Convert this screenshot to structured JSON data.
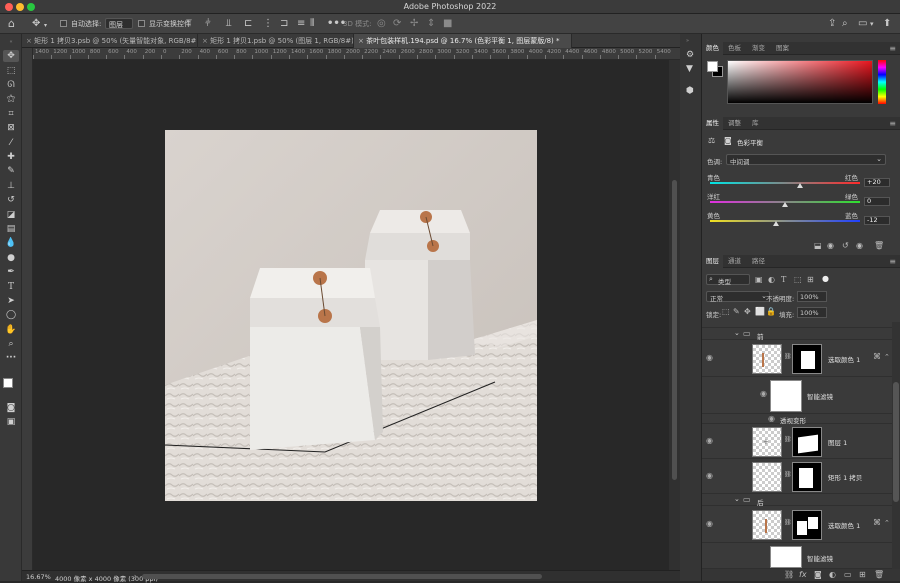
{
  "window": {
    "title": "Adobe Photoshop 2022"
  },
  "options_bar": {
    "auto_select_label": "自动选择:",
    "auto_select_value": "图层",
    "show_transform_label": "显示变换控件",
    "mode_3d_label": "3D 模式:"
  },
  "tabs": [
    {
      "label": "矩形 1 拷贝3.psb @ 50% (矢量智能对象, RGB/8#)"
    },
    {
      "label": "矩形 1 拷贝1.psb @ 50% (图层 1, RGB/8#)"
    },
    {
      "label": "茶叶包装样机.194.psd @ 16.7% (色彩平衡 1, 图层蒙版/8) *"
    }
  ],
  "ruler": {
    "ticks": [
      "1400",
      "1200",
      "1000",
      "800",
      "600",
      "400",
      "200",
      "0",
      "200",
      "400",
      "600",
      "800",
      "1000",
      "1200",
      "1400",
      "1600",
      "1800",
      "2000",
      "2200",
      "2400",
      "2600",
      "2800",
      "3000",
      "3200",
      "3400",
      "3600",
      "3800",
      "4000",
      "4200",
      "4400",
      "4600",
      "4800",
      "5000",
      "5200",
      "5400"
    ]
  },
  "status": {
    "zoom": "16.67%",
    "doc_info": "4000 像素 x 4000 像素 (300 ppi)"
  },
  "color_panel": {
    "tabs": [
      "颜色",
      "色板",
      "渐变",
      "图案"
    ],
    "colors": {
      "hue_base": "#e8151e"
    }
  },
  "properties_panel": {
    "tabs": [
      "属性",
      "调整",
      "库"
    ],
    "title": "色彩平衡",
    "tone_label": "色调:",
    "tone_value": "中间调",
    "sliders": [
      {
        "left": "青色",
        "right": "红色",
        "value": "+20",
        "level": 0.6
      },
      {
        "left": "洋红",
        "right": "绿色",
        "value": "0",
        "level": 0.5
      },
      {
        "left": "黄色",
        "right": "蓝色",
        "value": "-12",
        "level": 0.44
      }
    ]
  },
  "layers_panel": {
    "tabs": [
      "图层",
      "通道",
      "路径"
    ],
    "filter_label": "类型",
    "blend_mode": "正常",
    "opacity_label": "不透明度:",
    "opacity_value": "100%",
    "lock_label": "锁定:",
    "fill_label": "填充:",
    "fill_value": "100%",
    "group1": "前",
    "group2": "后",
    "layers": [
      {
        "name": "选取颜色 1"
      },
      {
        "name": "智能滤镜"
      },
      {
        "name": "透视变形"
      },
      {
        "name": "图层 1"
      },
      {
        "name": "矩形 1 拷贝"
      },
      {
        "name": "选取颜色 1"
      },
      {
        "name": "智能滤镜"
      }
    ]
  }
}
